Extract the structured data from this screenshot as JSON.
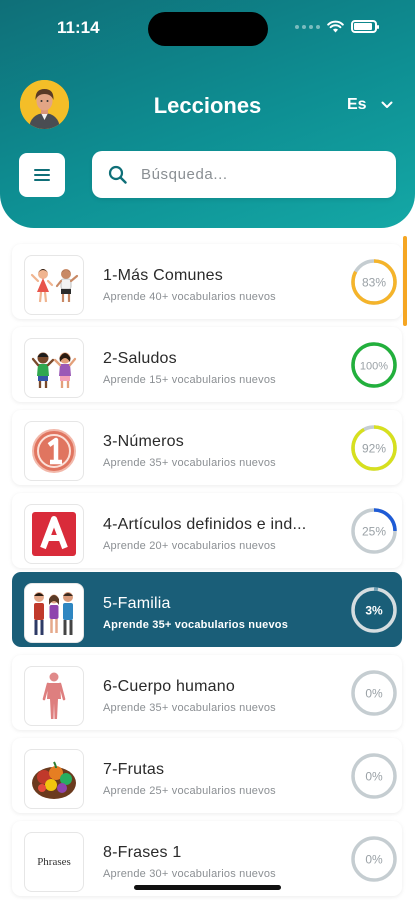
{
  "status_bar": {
    "time": "11:14"
  },
  "header": {
    "title": "Lecciones",
    "language": "Es"
  },
  "search": {
    "placeholder": "Búsqueda..."
  },
  "colors": {
    "header_teal": "#0e8f93",
    "active_card": "#1a5e78",
    "progress_orange": "#f5b42a",
    "progress_green": "#22b03c",
    "progress_lime": "#d7e01e",
    "progress_blue": "#1e5bd6",
    "progress_track": "#c5cdd1"
  },
  "lessons": [
    {
      "title": "1-Más Comunes",
      "subtitle": "Aprende 40+ vocabularios nuevos",
      "progress": 83,
      "progress_label": "83%",
      "color": "#f5b42a",
      "icon": "kids-waving-icon",
      "active": false
    },
    {
      "title": "2-Saludos",
      "subtitle": "Aprende 15+ vocabularios nuevos",
      "progress": 100,
      "progress_label": "100%",
      "color": "#22b03c",
      "icon": "greeting-kids-icon",
      "active": false
    },
    {
      "title": "3-Números",
      "subtitle": "Aprende 35+ vocabularios nuevos",
      "progress": 92,
      "progress_label": "92%",
      "color": "#d7e01e",
      "icon": "number-one-icon",
      "active": false
    },
    {
      "title": "4-Artículos definidos e ind...",
      "subtitle": "Aprende 20+ vocabularios nuevos",
      "progress": 25,
      "progress_label": "25%",
      "color": "#1e5bd6",
      "icon": "letter-a-icon",
      "active": false
    },
    {
      "title": "5-Familia",
      "subtitle": "Aprende 35+ vocabularios nuevos",
      "progress": 3,
      "progress_label": "3%",
      "color": "#ffffff",
      "icon": "family-icon",
      "active": true
    },
    {
      "title": "6-Cuerpo humano",
      "subtitle": "Aprende 35+ vocabularios nuevos",
      "progress": 0,
      "progress_label": "0%",
      "color": "#c5cdd1",
      "icon": "human-body-icon",
      "active": false
    },
    {
      "title": "7-Frutas",
      "subtitle": "Aprende 25+ vocabularios nuevos",
      "progress": 0,
      "progress_label": "0%",
      "color": "#c5cdd1",
      "icon": "fruit-basket-icon",
      "active": false
    },
    {
      "title": "8-Frases 1",
      "subtitle": "Aprende 30+ vocabularios nuevos",
      "progress": 0,
      "progress_label": "0%",
      "color": "#c5cdd1",
      "icon": "phrases-icon",
      "active": false,
      "icon_text": "Phrases"
    }
  ]
}
